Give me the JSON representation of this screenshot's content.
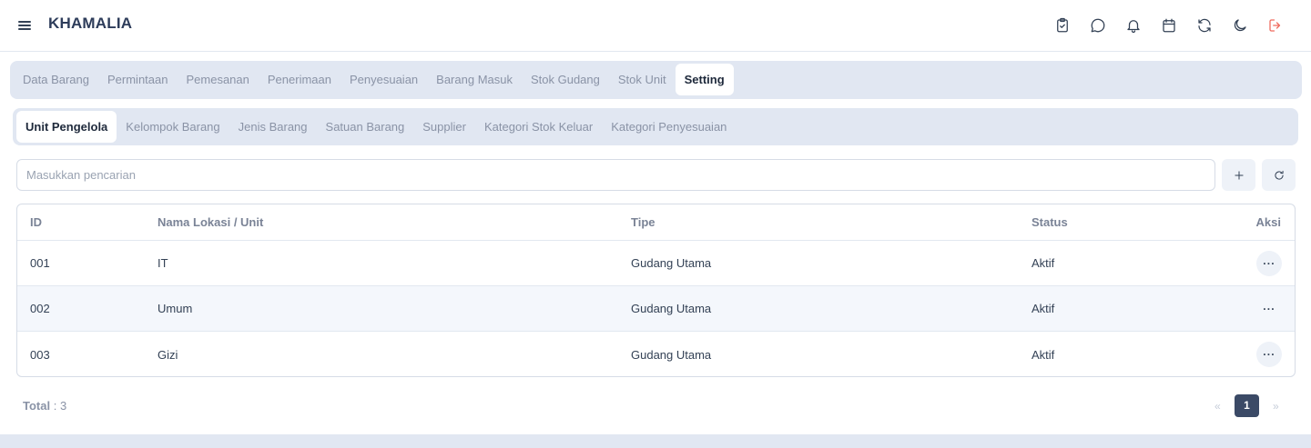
{
  "app": {
    "title": "KHAMALIA"
  },
  "header_icons": [
    "clipboard-check-icon",
    "chat-icon",
    "bell-icon",
    "calendar-icon",
    "refresh-icon",
    "moon-icon",
    "logout-icon"
  ],
  "main_tabs": [
    {
      "label": "Data Barang",
      "active": false
    },
    {
      "label": "Permintaan",
      "active": false
    },
    {
      "label": "Pemesanan",
      "active": false
    },
    {
      "label": "Penerimaan",
      "active": false
    },
    {
      "label": "Penyesuaian",
      "active": false
    },
    {
      "label": "Barang Masuk",
      "active": false
    },
    {
      "label": "Stok Gudang",
      "active": false
    },
    {
      "label": "Stok Unit",
      "active": false
    },
    {
      "label": "Setting",
      "active": true
    }
  ],
  "sub_tabs": [
    {
      "label": "Unit Pengelola",
      "active": true
    },
    {
      "label": "Kelompok Barang",
      "active": false
    },
    {
      "label": "Jenis Barang",
      "active": false
    },
    {
      "label": "Satuan Barang",
      "active": false
    },
    {
      "label": "Supplier",
      "active": false
    },
    {
      "label": "Kategori Stok Keluar",
      "active": false
    },
    {
      "label": "Kategori Penyesuaian",
      "active": false
    }
  ],
  "search": {
    "placeholder": "Masukkan pencarian",
    "value": ""
  },
  "table": {
    "headers": {
      "id": "ID",
      "nama": "Nama Lokasi / Unit",
      "tipe": "Tipe",
      "status": "Status",
      "aksi": "Aksi"
    },
    "rows": [
      {
        "id": "001",
        "nama": "IT",
        "tipe": "Gudang Utama",
        "status": "Aktif",
        "aksi": "···"
      },
      {
        "id": "002",
        "nama": "Umum",
        "tipe": "Gudang Utama",
        "status": "Aktif",
        "aksi": "···"
      },
      {
        "id": "003",
        "nama": "Gizi",
        "tipe": "Gudang Utama",
        "status": "Aktif",
        "aksi": "···"
      }
    ]
  },
  "footer": {
    "total_label": "Total",
    "total_value": ": 3"
  },
  "pagination": {
    "prev": "«",
    "current": "1",
    "next": "»"
  },
  "colors": {
    "accent": "#3b4a66",
    "tab_bg": "#e1e7f2",
    "logout": "#ef6b5e"
  }
}
